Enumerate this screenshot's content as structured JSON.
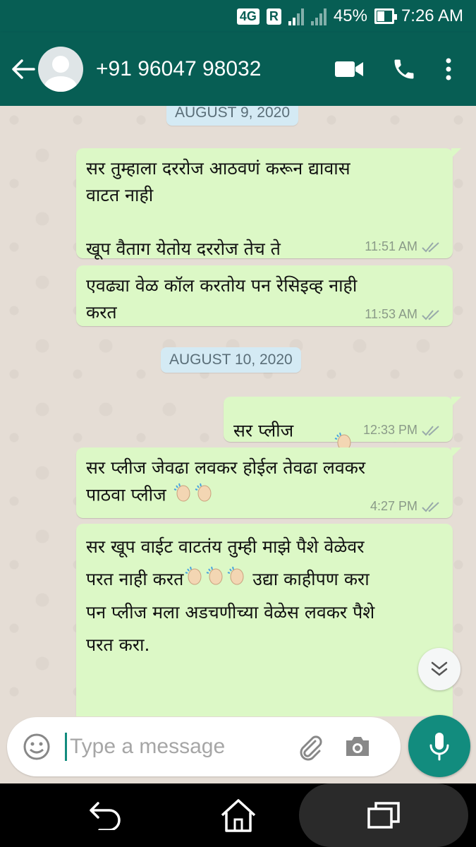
{
  "status": {
    "network": "4G",
    "roaming": "R",
    "sim_badge": "1",
    "battery": "45%",
    "battery_level": 0.45,
    "time": "7:26 AM"
  },
  "header": {
    "contact": "+91 96047 98032"
  },
  "dates": {
    "first": "AUGUST 9, 2020",
    "second": "AUGUST 10, 2020"
  },
  "messages": [
    {
      "text": "सर तुम्हाला दररोज आठवणं करून द्यावास\nवाटत नाही\n\nखूप वैताग येतोय दररोज तेच ते",
      "time": "11:51 AM"
    },
    {
      "text": "एवढ्या वेळ कॉल करतोय पन रेसिइव्ह नाही\nकरत",
      "time": "11:53 AM"
    },
    {
      "text": "सर प्लीज",
      "time": "12:33 PM"
    },
    {
      "text_line1": "सर प्लीज जेवढा लवकर होईल तेवढा लवकर",
      "text_line2": "पाठवा प्लीज",
      "time": "4:27 PM"
    },
    {
      "text_a": "सर खूप वाईट वाटतंय तुम्ही माझे पैशे वेळेवर",
      "text_b": "परत नाही करत",
      "text_c": " उद्या काहीपण करा",
      "text_d": "पन प्लीज मला अडचणीच्या वेळेस लवकर पैशे\nपरत करा."
    }
  ],
  "input": {
    "placeholder": "Type a message"
  },
  "colors": {
    "header": "#075e54",
    "bubble_out": "#dcf8c6",
    "date_chip": "#d4eaf4",
    "mic": "#128c7e"
  }
}
